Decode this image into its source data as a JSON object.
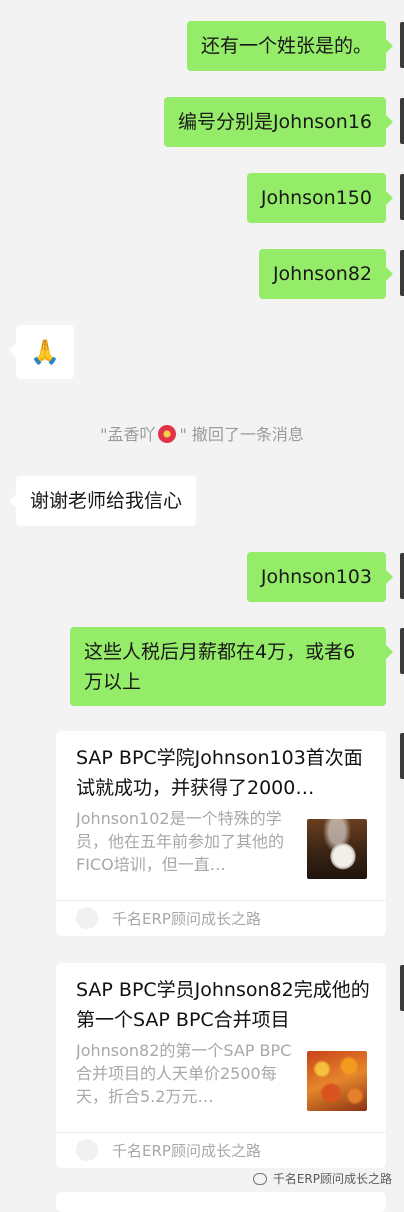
{
  "messages": {
    "m1": "还有一个姓张是的。",
    "m2": "编号分别是Johnson16",
    "m3": "Johnson150",
    "m4": "Johnson82",
    "sticker": "🙏",
    "recall_pre": "\"孟香吖",
    "recall_post": "\" 撤回了一条消息",
    "m5": "谢谢老师给我信心",
    "m6": "Johnson103",
    "m7": "这些人税后月薪都在4万，或者6万以上"
  },
  "cards": [
    {
      "title": "SAP BPC学院Johnson103首次面试就成功，并获得了2000…",
      "desc": "Johnson102是一个特殊的学员，他在五年前参加了其他的FICO培训，但一直…",
      "source": "千名ERP顾问成长之路"
    },
    {
      "title": "SAP BPC学员Johnson82完成他的第一个SAP BPC合并项目",
      "desc": "Johnson82的第一个SAP BPC合并项目的人天单价2500每天，折合5.2万元…",
      "source": "千名ERP顾问成长之路"
    }
  ],
  "watermark": "千名ERP顾问成长之路",
  "colors": {
    "outgoing_bubble": "#95ec69",
    "incoming_bubble": "#ffffff",
    "background": "#f3f3f3"
  }
}
